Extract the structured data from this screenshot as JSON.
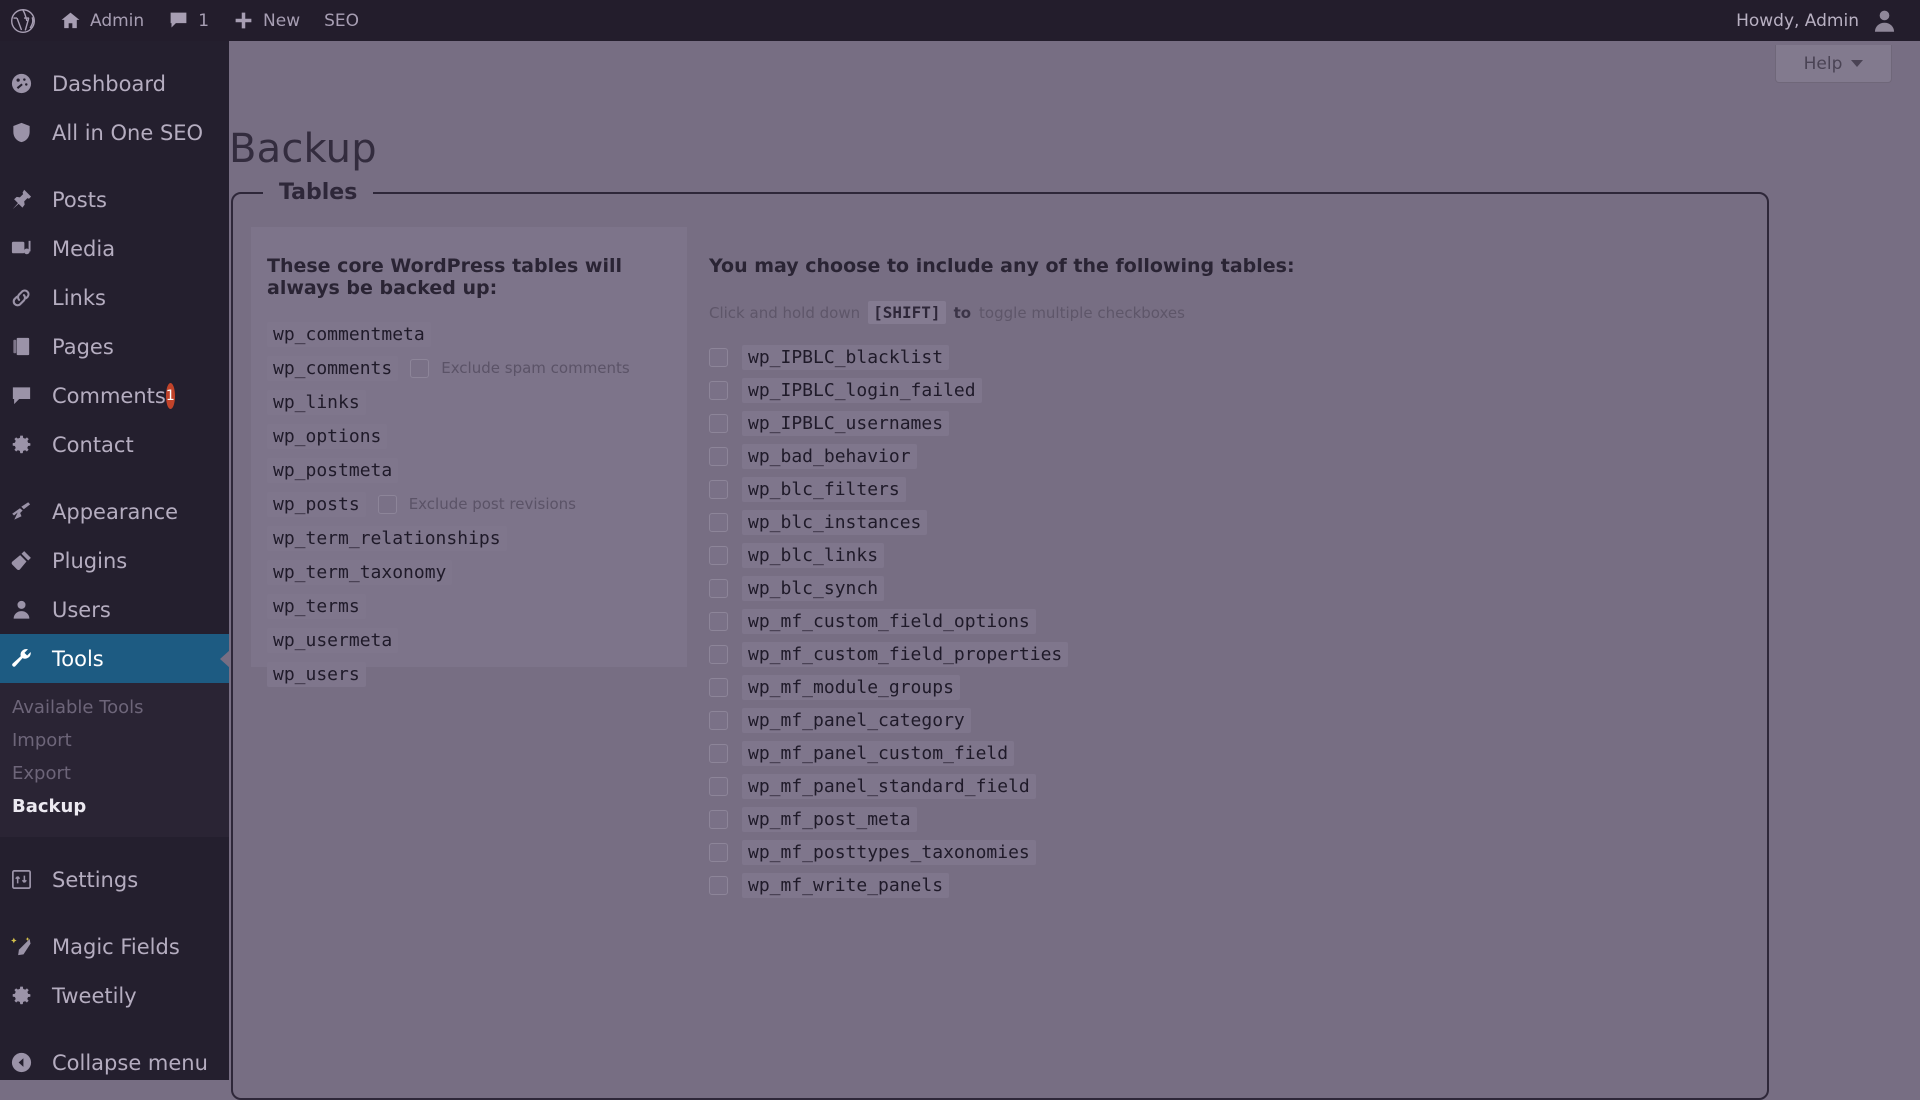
{
  "adminbar": {
    "logo_icon": "wordpress-logo-icon",
    "items": [
      {
        "label": "Admin",
        "icon": "home-icon"
      },
      {
        "label": "1",
        "icon": "comment-bubble-icon"
      },
      {
        "label": "New",
        "icon": "plus-icon"
      },
      {
        "label": "SEO",
        "icon": ""
      }
    ],
    "greeting": "Howdy, Admin",
    "avatar_icon": "user-avatar-icon"
  },
  "sidebar": {
    "groups": [
      {
        "items": [
          {
            "label": "Dashboard",
            "icon": "dashboard-icon",
            "current": false
          },
          {
            "label": "All in One SEO",
            "icon": "shield-icon",
            "current": false
          }
        ]
      },
      {
        "items": [
          {
            "label": "Posts",
            "icon": "pin-icon",
            "current": false
          },
          {
            "label": "Media",
            "icon": "media-icon",
            "current": false
          },
          {
            "label": "Links",
            "icon": "link-icon",
            "current": false
          },
          {
            "label": "Pages",
            "icon": "pages-icon",
            "current": false
          },
          {
            "label": "Comments",
            "icon": "comment-bubble-icon",
            "current": false,
            "badge": "1"
          },
          {
            "label": "Contact",
            "icon": "gear-icon",
            "current": false
          }
        ]
      },
      {
        "items": [
          {
            "label": "Appearance",
            "icon": "paintbrush-icon",
            "current": false
          },
          {
            "label": "Plugins",
            "icon": "plug-icon",
            "current": false
          },
          {
            "label": "Users",
            "icon": "user-icon",
            "current": false
          },
          {
            "label": "Tools",
            "icon": "wrench-icon",
            "current": true
          }
        ]
      }
    ],
    "submenu": [
      {
        "label": "Available Tools",
        "current": false
      },
      {
        "label": "Import",
        "current": false
      },
      {
        "label": "Export",
        "current": false
      },
      {
        "label": "Backup",
        "current": true
      }
    ],
    "groups_after": [
      {
        "items": [
          {
            "label": "Settings",
            "icon": "settings-icon",
            "current": false
          }
        ]
      },
      {
        "items": [
          {
            "label": "Magic Fields",
            "icon": "magic-wand-icon",
            "current": false
          },
          {
            "label": "Tweetily",
            "icon": "gear-icon",
            "current": false
          }
        ]
      }
    ],
    "collapse": {
      "label": "Collapse menu",
      "icon": "collapse-arrow-icon"
    }
  },
  "help_button": {
    "label": "Help",
    "icon": "chevron-down-icon"
  },
  "page": {
    "title": "Backup"
  },
  "fieldset": {
    "legend": "Tables"
  },
  "core_tables": {
    "heading": "These core WordPress tables will always be backed up:",
    "rows": [
      {
        "name": "wp_commentmeta",
        "checkbox": false,
        "checkbox_label": ""
      },
      {
        "name": "wp_comments",
        "checkbox": true,
        "checkbox_label": "Exclude spam comments",
        "checked": false
      },
      {
        "name": "wp_links",
        "checkbox": false,
        "checkbox_label": ""
      },
      {
        "name": "wp_options",
        "checkbox": false,
        "checkbox_label": ""
      },
      {
        "name": "wp_postmeta",
        "checkbox": false,
        "checkbox_label": ""
      },
      {
        "name": "wp_posts",
        "checkbox": true,
        "checkbox_label": "Exclude post revisions",
        "checked": false
      },
      {
        "name": "wp_term_relationships",
        "checkbox": false,
        "checkbox_label": ""
      },
      {
        "name": "wp_term_taxonomy",
        "checkbox": false,
        "checkbox_label": ""
      },
      {
        "name": "wp_terms",
        "checkbox": false,
        "checkbox_label": ""
      },
      {
        "name": "wp_usermeta",
        "checkbox": false,
        "checkbox_label": ""
      },
      {
        "name": "wp_users",
        "checkbox": false,
        "checkbox_label": ""
      }
    ]
  },
  "optional_tables": {
    "heading": "You may choose to include any of the following tables:",
    "hint_prefix": "Click and hold down",
    "hint_key": "[SHIFT]",
    "hint_mid": "to",
    "hint_suffix": "toggle multiple checkboxes",
    "rows": [
      {
        "name": "wp_IPBLC_blacklist",
        "checked": false
      },
      {
        "name": "wp_IPBLC_login_failed",
        "checked": false
      },
      {
        "name": "wp_IPBLC_usernames",
        "checked": false
      },
      {
        "name": "wp_bad_behavior",
        "checked": false
      },
      {
        "name": "wp_blc_filters",
        "checked": false
      },
      {
        "name": "wp_blc_instances",
        "checked": false
      },
      {
        "name": "wp_blc_links",
        "checked": false
      },
      {
        "name": "wp_blc_synch",
        "checked": false
      },
      {
        "name": "wp_mf_custom_field_options",
        "checked": false
      },
      {
        "name": "wp_mf_custom_field_properties",
        "checked": false
      },
      {
        "name": "wp_mf_module_groups",
        "checked": false
      },
      {
        "name": "wp_mf_panel_category",
        "checked": false
      },
      {
        "name": "wp_mf_panel_custom_field",
        "checked": false
      },
      {
        "name": "wp_mf_panel_standard_field",
        "checked": false
      },
      {
        "name": "wp_mf_post_meta",
        "checked": false
      },
      {
        "name": "wp_mf_posttypes_taxonomies",
        "checked": false
      },
      {
        "name": "wp_mf_write_panels",
        "checked": false
      }
    ]
  },
  "colors": {
    "overlay_background": "#776e83",
    "adminbar": "#231d2c",
    "sidebar": "#241f2e",
    "submenu": "#2a2434",
    "current_menu": "#1d5b82",
    "badge": "#c1432a",
    "text_dark": "#2a2434"
  }
}
